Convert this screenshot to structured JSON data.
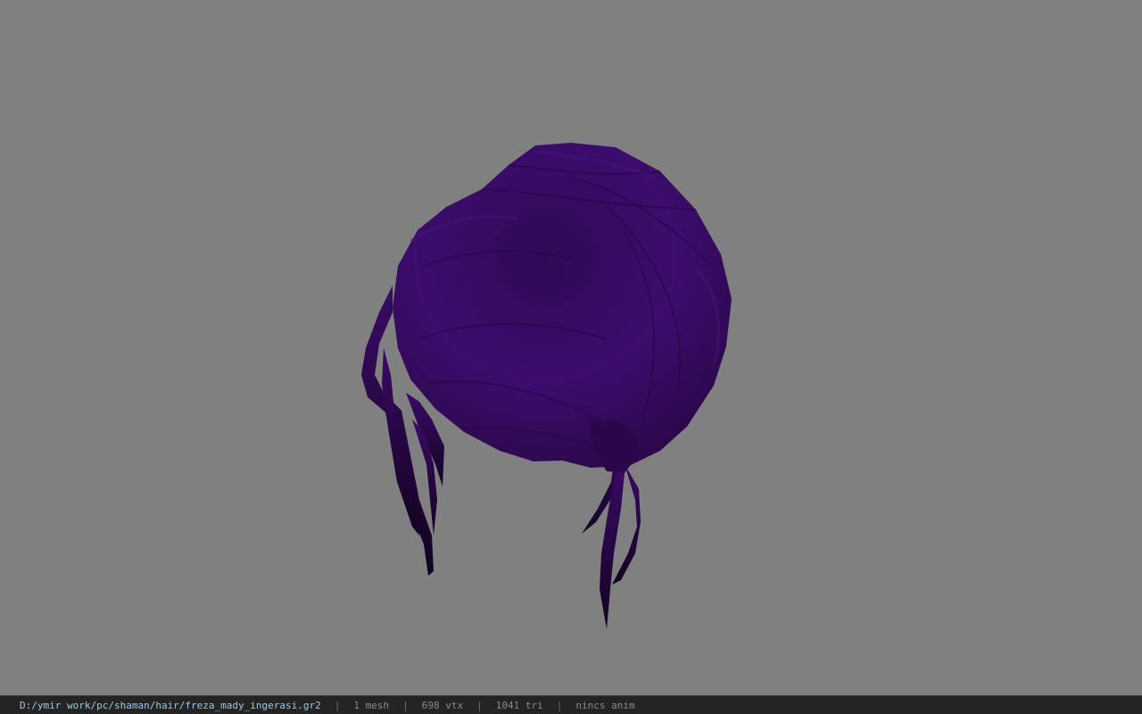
{
  "viewport": {
    "background_color": "#808080",
    "model_color": "#3a0a66",
    "model_shade_color": "#24063f",
    "model": "hair-mesh"
  },
  "statusbar": {
    "file_path": "D:/ymir work/pc/shaman/hair/freza_mady_ingerasi.gr2",
    "separator": "|",
    "mesh_count": "1 mesh",
    "vertex_count": "698 vtx",
    "triangle_count": "1041 tri",
    "animation_status": "nincs anim",
    "path_color": "#9fc8e0",
    "text_color": "#8a8a8a",
    "background_color": "#242424"
  }
}
